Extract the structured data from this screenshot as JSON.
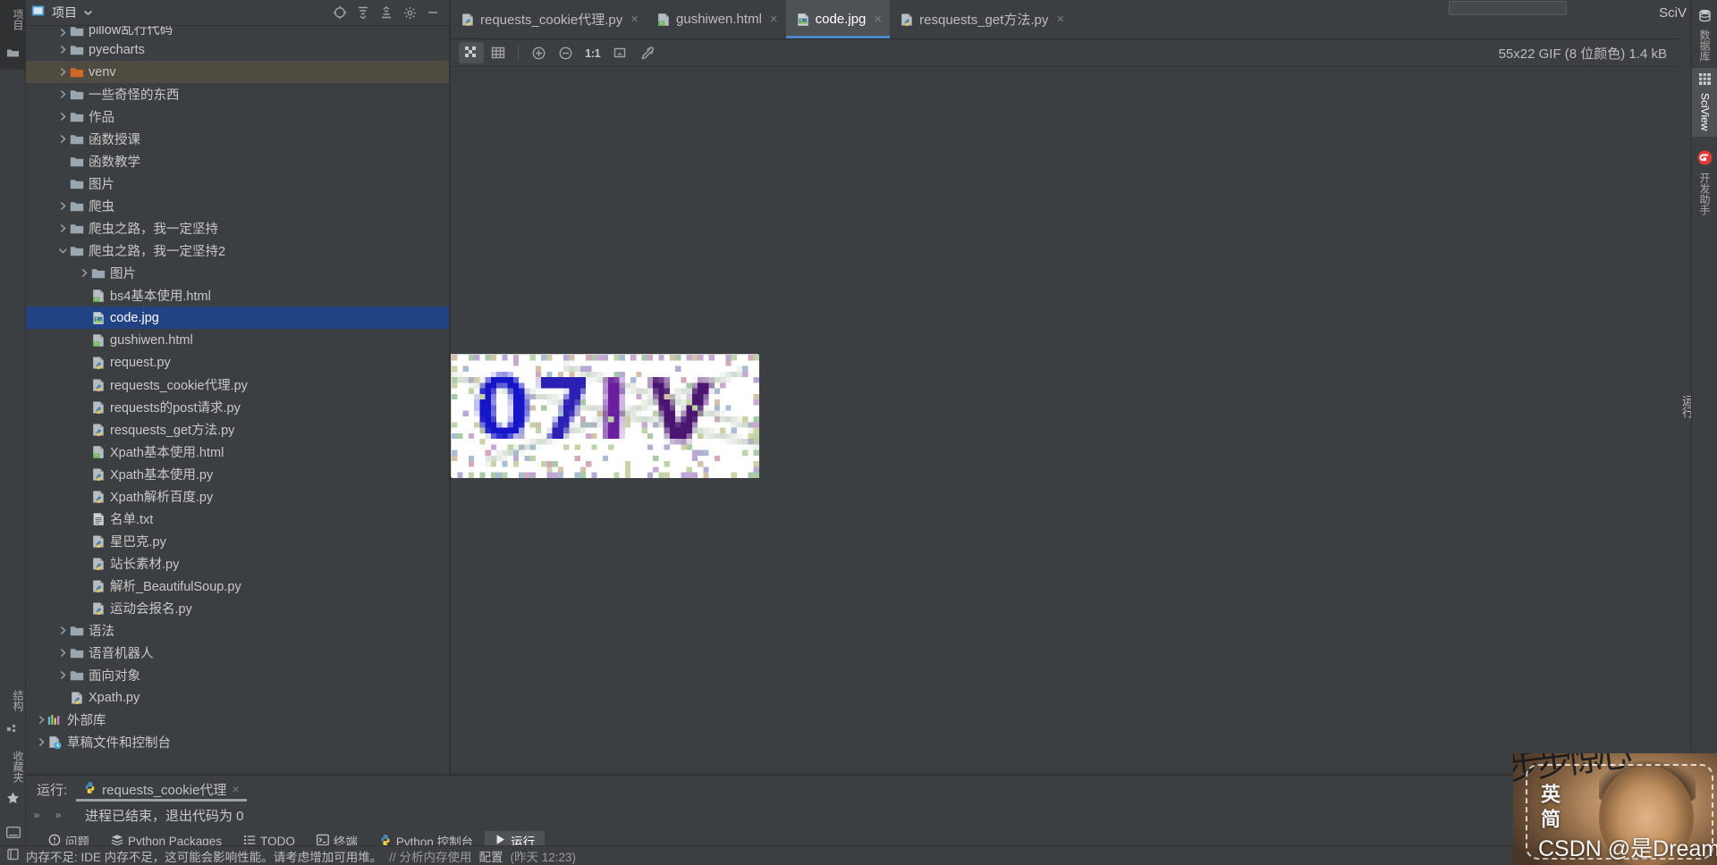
{
  "window": {
    "minimize_label": "—",
    "sciview_peek_label": "SciV"
  },
  "left_rail": {
    "items": [
      {
        "name": "project-tool-icon",
        "label": "项目"
      },
      {
        "name": "structure-tool",
        "label": "结构"
      },
      {
        "name": "bookmarks-tool",
        "label": "收藏夹"
      }
    ]
  },
  "project_panel": {
    "title": "项目",
    "toolbar": [
      {
        "name": "select-opened-file-button",
        "tooltip": "选择打开的文件"
      },
      {
        "name": "expand-all-button",
        "tooltip": "全部展开"
      },
      {
        "name": "collapse-all-button",
        "tooltip": "全部折叠"
      },
      {
        "name": "settings-button",
        "tooltip": "设置"
      },
      {
        "name": "hide-button",
        "tooltip": "隐藏"
      }
    ],
    "tree": [
      {
        "label": "pillow乱行代码",
        "type": "folder",
        "indent": 1,
        "arrow": "right",
        "partial": true
      },
      {
        "label": "pyecharts",
        "type": "folder",
        "indent": 1,
        "arrow": "right"
      },
      {
        "label": "venv",
        "type": "folder-venv",
        "indent": 1,
        "arrow": "right",
        "highlight": "venv"
      },
      {
        "label": "一些奇怪的东西",
        "type": "folder",
        "indent": 1,
        "arrow": "right"
      },
      {
        "label": "作品",
        "type": "folder",
        "indent": 1,
        "arrow": "right"
      },
      {
        "label": "函数授课",
        "type": "folder",
        "indent": 1,
        "arrow": "right"
      },
      {
        "label": "函数教学",
        "type": "folder",
        "indent": 1,
        "arrow": "none"
      },
      {
        "label": "图片",
        "type": "folder",
        "indent": 1,
        "arrow": "none"
      },
      {
        "label": "爬虫",
        "type": "folder",
        "indent": 1,
        "arrow": "right"
      },
      {
        "label": "爬虫之路，我一定坚持",
        "type": "folder",
        "indent": 1,
        "arrow": "right"
      },
      {
        "label": "爬虫之路，我一定坚持2",
        "type": "folder",
        "indent": 1,
        "arrow": "down"
      },
      {
        "label": "图片",
        "type": "folder",
        "indent": 2,
        "arrow": "right"
      },
      {
        "label": "bs4基本使用.html",
        "type": "html",
        "indent": 2,
        "arrow": "none"
      },
      {
        "label": "code.jpg",
        "type": "image",
        "indent": 2,
        "arrow": "none",
        "highlight": "selected"
      },
      {
        "label": "gushiwen.html",
        "type": "html",
        "indent": 2,
        "arrow": "none"
      },
      {
        "label": "request.py",
        "type": "python",
        "indent": 2,
        "arrow": "none"
      },
      {
        "label": "requests_cookie代理.py",
        "type": "python",
        "indent": 2,
        "arrow": "none"
      },
      {
        "label": "requests的post请求.py",
        "type": "python",
        "indent": 2,
        "arrow": "none"
      },
      {
        "label": "resquests_get方法.py",
        "type": "python",
        "indent": 2,
        "arrow": "none"
      },
      {
        "label": "Xpath基本使用.html",
        "type": "html",
        "indent": 2,
        "arrow": "none"
      },
      {
        "label": "Xpath基本使用.py",
        "type": "python",
        "indent": 2,
        "arrow": "none"
      },
      {
        "label": "Xpath解析百度.py",
        "type": "python",
        "indent": 2,
        "arrow": "none"
      },
      {
        "label": "名单.txt",
        "type": "text",
        "indent": 2,
        "arrow": "none"
      },
      {
        "label": "星巴克.py",
        "type": "python",
        "indent": 2,
        "arrow": "none"
      },
      {
        "label": "站长素材.py",
        "type": "python",
        "indent": 2,
        "arrow": "none"
      },
      {
        "label": "解析_BeautifulSoup.py",
        "type": "python",
        "indent": 2,
        "arrow": "none"
      },
      {
        "label": "运动会报名.py",
        "type": "python",
        "indent": 2,
        "arrow": "none"
      },
      {
        "label": "语法",
        "type": "folder",
        "indent": 1,
        "arrow": "right"
      },
      {
        "label": "语音机器人",
        "type": "folder",
        "indent": 1,
        "arrow": "right"
      },
      {
        "label": "面向对象",
        "type": "folder",
        "indent": 1,
        "arrow": "right"
      },
      {
        "label": "Xpath.py",
        "type": "python",
        "indent": 1,
        "arrow": "none"
      },
      {
        "label": "外部库",
        "type": "library",
        "indent": 0,
        "arrow": "right"
      },
      {
        "label": "草稿文件和控制台",
        "type": "scratch",
        "indent": 0,
        "arrow": "right"
      }
    ]
  },
  "editor": {
    "tabs": [
      {
        "label": "requests_cookie代理.py",
        "icon": "python-file-icon",
        "active": false,
        "close": "×"
      },
      {
        "label": "gushiwen.html",
        "icon": "html-file-icon",
        "active": false,
        "close": "×"
      },
      {
        "label": "code.jpg",
        "icon": "image-file-icon",
        "active": true,
        "close": "×"
      },
      {
        "label": "resquests_get方法.py",
        "icon": "python-file-icon",
        "active": false,
        "close": "×"
      }
    ],
    "image_toolbar": {
      "buttons": [
        {
          "name": "toggle-transparency-chessboard-button",
          "active": true
        },
        {
          "name": "toggle-grid-button",
          "active": false
        },
        {
          "name": "zoom-in-button",
          "active": false
        },
        {
          "name": "zoom-out-button",
          "active": false
        },
        {
          "name": "actual-size-button",
          "label": "1:1",
          "active": false
        },
        {
          "name": "fit-to-window-button",
          "active": false
        },
        {
          "name": "color-picker-button",
          "active": false
        }
      ],
      "ratio_label": "1:1"
    },
    "image_info": "55x22 GIF (8 位颜色) 1.4 kB",
    "captcha_text": "07IV",
    "right_strip_label": "运行"
  },
  "right_rail": {
    "items": [
      {
        "label": "数据库",
        "icon": "database-icon",
        "active": false
      },
      {
        "label": "SciView",
        "icon": "grid-icon",
        "active": true
      },
      {
        "label": "开发助手",
        "icon": "assistant-icon",
        "active": false
      }
    ]
  },
  "run_panel": {
    "title": "运行:",
    "config_name": "requests_cookie代理",
    "close": "×",
    "output": "进程已结束，退出代码为  0",
    "chevron": "»"
  },
  "toolwindow_bar": {
    "items": [
      {
        "label": "问题",
        "icon": "problems-icon",
        "active": false
      },
      {
        "label": "Python Packages",
        "icon": "packages-icon",
        "active": false
      },
      {
        "label": "TODO",
        "icon": "todo-icon",
        "active": false
      },
      {
        "label": "终端",
        "icon": "terminal-icon",
        "active": false
      },
      {
        "label": "Python 控制台",
        "icon": "python-console-icon",
        "active": false
      },
      {
        "label": "运行",
        "icon": "run-icon",
        "active": true
      }
    ]
  },
  "status_bar": {
    "message": "内存不足: IDE 内存不足，这可能会影响性能。请考虑增加可用堆。",
    "link_analyze": "// 分析内存使用",
    "link_configure": "配置",
    "timestamp": "(昨天 12:23)"
  },
  "video_overlay": {
    "calligraphy": "步步惊心",
    "vertical_text": "英简",
    "watermark": "CSDN @是Dream呀"
  },
  "colors": {
    "bg": "#3c3f41",
    "panel": "#2f3133",
    "selection_blue": "#214283",
    "selection_olive": "#4f4b41",
    "accent": "#4a88c7",
    "text": "#bbbbbb"
  }
}
